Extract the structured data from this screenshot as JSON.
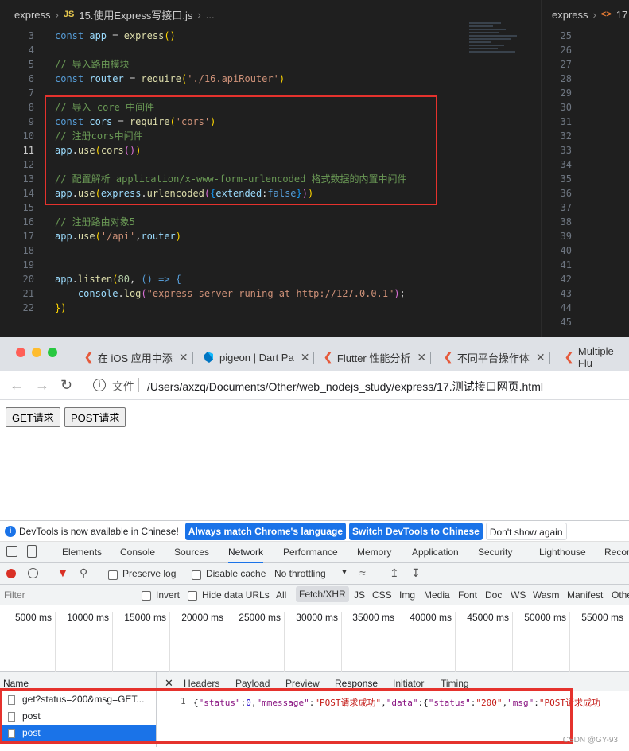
{
  "editor": {
    "breadcrumb": {
      "folder": "express",
      "file_badge": "JS",
      "file": "15.使用Express写接口.js",
      "more": "..."
    },
    "lines": [
      {
        "n": "3"
      },
      {
        "n": "4"
      },
      {
        "n": "5"
      },
      {
        "n": "6"
      },
      {
        "n": "7"
      },
      {
        "n": "8"
      },
      {
        "n": "9"
      },
      {
        "n": "10"
      },
      {
        "n": "11"
      },
      {
        "n": "12"
      },
      {
        "n": "13"
      },
      {
        "n": "14"
      },
      {
        "n": "15"
      },
      {
        "n": "16"
      },
      {
        "n": "17"
      },
      {
        "n": "18"
      },
      {
        "n": "19"
      },
      {
        "n": "20"
      },
      {
        "n": "21"
      },
      {
        "n": "22"
      }
    ],
    "code": {
      "l3": {
        "kw": "const",
        "var": "app",
        "eq": " = ",
        "fn": "express",
        "tail": "()"
      },
      "l5": "// 导入路由模块",
      "l6": {
        "kw": "const",
        "var": "router",
        "eq": " = ",
        "fn": "require",
        "str": "'./16.apiRouter'"
      },
      "l8": "// 导入 core 中间件",
      "l9": {
        "kw": "const",
        "var": "cors",
        "eq": " = ",
        "fn": "require",
        "str": "'cors'"
      },
      "l10": "// 注册cors中间件",
      "l11": {
        "obj": "app",
        "fn": "use",
        "arg_fn": "cors"
      },
      "l13": "// 配置解析 application/x-www-form-urlencoded 格式数据的内置中间件",
      "l14": {
        "obj": "app",
        "fn": "use",
        "obj2": "express",
        "fn2": "urlencoded",
        "key": "extended",
        "val": "false"
      },
      "l16": "// 注册路由对象5",
      "l17": {
        "obj": "app",
        "fn": "use",
        "str": "'/api'",
        "arg": "router"
      },
      "l20": {
        "obj": "app",
        "fn": "listen",
        "num": "80",
        "arrow": "() => {"
      },
      "l21": {
        "obj": "console",
        "fn": "log",
        "str_a": "\"express server runing at ",
        "link": "http://127.0.0.1",
        "str_b": "\""
      },
      "l22": "})"
    },
    "right_pane": {
      "folder": "express",
      "file_badge": "<>",
      "file_prefix": "17",
      "lines": [
        "25",
        "26",
        "27",
        "28",
        "29",
        "30",
        "31",
        "32",
        "33",
        "34",
        "35",
        "36",
        "37",
        "38",
        "39",
        "40",
        "41",
        "42",
        "43",
        "44",
        "45"
      ]
    }
  },
  "browser": {
    "tabs": [
      {
        "label": "在 iOS 应用中添",
        "icon": "flutter-icon"
      },
      {
        "label": "pigeon | Dart Pa",
        "icon": "dart-icon"
      },
      {
        "label": "Flutter 性能分析",
        "icon": "flutter-icon"
      },
      {
        "label": "不同平台操作体",
        "icon": "flutter-icon"
      },
      {
        "label": "Multiple Flu",
        "icon": "flutter-icon"
      }
    ],
    "close_glyph": "✕",
    "address": {
      "scheme_label": "文件",
      "url": "/Users/axzq/Documents/Other/web_nodejs_study/express/17.测试接口网页.html"
    },
    "page": {
      "get_button": "GET请求",
      "post_button": "POST请求"
    }
  },
  "devtools": {
    "infobar": {
      "message": "DevTools is now available in Chinese!",
      "btn_match": "Always match Chrome's language",
      "btn_switch": "Switch DevTools to Chinese",
      "btn_dismiss": "Don't show again"
    },
    "tabs": [
      "Elements",
      "Console",
      "Sources",
      "Network",
      "Performance",
      "Memory",
      "Application",
      "Security",
      "Lighthouse",
      "Recor"
    ],
    "active_tab": "Network",
    "toolbar": {
      "preserve_log": "Preserve log",
      "disable_cache": "Disable cache",
      "throttling": "No throttling"
    },
    "filter": {
      "placeholder": "Filter",
      "invert": "Invert",
      "hide_data_urls": "Hide data URLs",
      "types": [
        "All",
        "Fetch/XHR",
        "JS",
        "CSS",
        "Img",
        "Media",
        "Font",
        "Doc",
        "WS",
        "Wasm",
        "Manifest",
        "Othe"
      ],
      "active_type": "Fetch/XHR"
    },
    "timeline_ticks": [
      "5000 ms",
      "10000 ms",
      "15000 ms",
      "20000 ms",
      "25000 ms",
      "30000 ms",
      "35000 ms",
      "40000 ms",
      "45000 ms",
      "50000 ms",
      "55000 ms"
    ],
    "requests": {
      "header": "Name",
      "rows": [
        "get?status=200&msg=GET...",
        "post",
        "post"
      ],
      "selected_index": 2
    },
    "detail_tabs": [
      "Headers",
      "Payload",
      "Preview",
      "Response",
      "Initiator",
      "Timing"
    ],
    "active_detail_tab": "Response",
    "response": {
      "line_number": "1",
      "tokens": [
        {
          "t": "{",
          "c": "punc"
        },
        {
          "t": "\"status\"",
          "c": "key"
        },
        {
          "t": ":",
          "c": "punc"
        },
        {
          "t": "0",
          "c": "num"
        },
        {
          "t": ",",
          "c": "punc"
        },
        {
          "t": "\"mmessage\"",
          "c": "key"
        },
        {
          "t": ":",
          "c": "punc"
        },
        {
          "t": "\"POST请求成功\"",
          "c": "str"
        },
        {
          "t": ",",
          "c": "punc"
        },
        {
          "t": "\"data\"",
          "c": "key"
        },
        {
          "t": ":{",
          "c": "punc"
        },
        {
          "t": "\"status\"",
          "c": "key"
        },
        {
          "t": ":",
          "c": "punc"
        },
        {
          "t": "\"200\"",
          "c": "str"
        },
        {
          "t": ",",
          "c": "punc"
        },
        {
          "t": "\"msg\"",
          "c": "key"
        },
        {
          "t": ":",
          "c": "punc"
        },
        {
          "t": "\"POST请求成功",
          "c": "str"
        }
      ]
    }
  },
  "watermark": "CSDN @GY-93",
  "colors": {
    "highlight_box": "#e5322d",
    "accent": "#1a73e8"
  }
}
